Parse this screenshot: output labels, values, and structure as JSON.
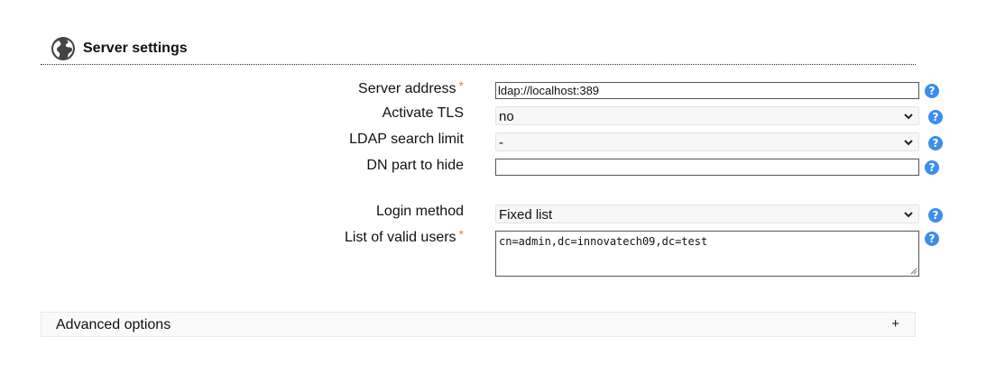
{
  "section": {
    "title": "Server settings",
    "icon": "globe-icon"
  },
  "fields": {
    "server_address": {
      "label": "Server address",
      "required_mark": "*",
      "value": "ldap://localhost:389"
    },
    "activate_tls": {
      "label": "Activate TLS",
      "value": "no"
    },
    "ldap_search_limit": {
      "label": "LDAP search limit",
      "value": "-"
    },
    "dn_part_to_hide": {
      "label": "DN part to hide",
      "value": ""
    },
    "login_method": {
      "label": "Login method",
      "value": "Fixed list"
    },
    "valid_users": {
      "label": "List of valid users",
      "required_mark": "*",
      "value": "cn=admin,dc=innovatech09,dc=test"
    }
  },
  "help": {
    "symbol": "?"
  },
  "advanced": {
    "label": "Advanced options",
    "toggle": "+"
  },
  "colors": {
    "required": "#e8823a",
    "help": "#3b8eea",
    "globe": "#444444"
  }
}
